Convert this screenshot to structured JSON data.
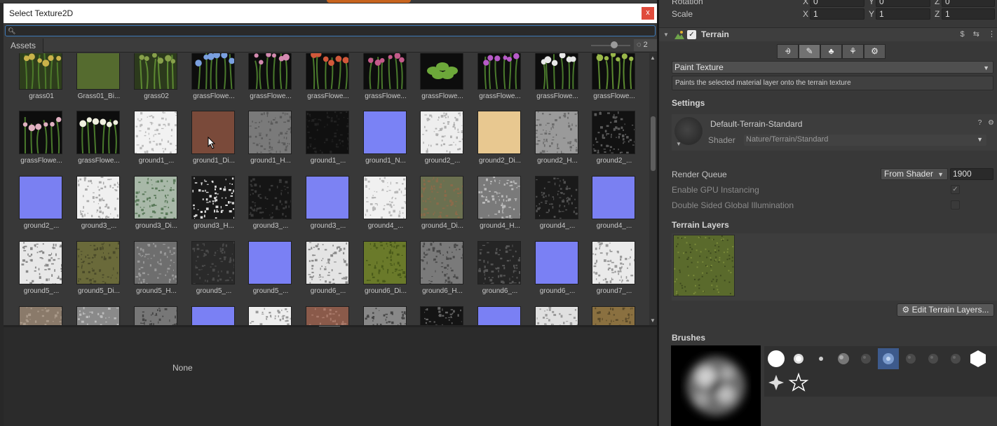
{
  "picker": {
    "title": "Select Texture2D",
    "close_label": "x",
    "search_value": "",
    "tab_assets": "Assets",
    "hidden_count": "2",
    "none_label": "None",
    "tiles": [
      {
        "label": "grass01",
        "fill": "#2e3e1c",
        "kind": "plant",
        "c1": "#4d7a2a",
        "c2": "#c9b24a"
      },
      {
        "label": "Grass01_Bi...",
        "fill": "#556b2f",
        "kind": "tex"
      },
      {
        "label": "grass02",
        "fill": "#2c3a1c",
        "kind": "plant",
        "c1": "#5d8a32",
        "c2": "#87a04a"
      },
      {
        "label": "grassFlowe...",
        "fill": "#0d0d0d",
        "kind": "plant",
        "c1": "#4a7a2c",
        "c2": "#7aa0e0"
      },
      {
        "label": "grassFlowe...",
        "fill": "#0d0d0d",
        "kind": "plant",
        "c1": "#4a7a2c",
        "c2": "#d48ab0"
      },
      {
        "label": "grassFlowe...",
        "fill": "#0d0d0d",
        "kind": "plant",
        "c1": "#4a7a2c",
        "c2": "#d2583a"
      },
      {
        "label": "grassFlowe...",
        "fill": "#0d0d0d",
        "kind": "plant",
        "c1": "#4a7a2c",
        "c2": "#c45a8a"
      },
      {
        "label": "grassFlowe...",
        "fill": "#0d0d0d",
        "kind": "leaf",
        "c1": "#6da83a",
        "c2": "#c1d27a"
      },
      {
        "label": "grassFlowe...",
        "fill": "#0d0d0d",
        "kind": "plant",
        "c1": "#4a7a2c",
        "c2": "#b75ac8"
      },
      {
        "label": "grassFlowe...",
        "fill": "#0d0d0d",
        "kind": "plant",
        "c1": "#4a7a2c",
        "c2": "#e8e8e8"
      },
      {
        "label": "grassFlowe...",
        "fill": "#0d0d0d",
        "kind": "plant",
        "c1": "#5c8a30",
        "c2": "#9ab84a"
      },
      {
        "label": "grassFlowe...",
        "fill": "#0d0d0d",
        "kind": "plant",
        "c1": "#4a7a2c",
        "c2": "#e0b0c0"
      },
      {
        "label": "grassFlowe...",
        "fill": "#0d0d0d",
        "kind": "plant",
        "c1": "#4a7a2c",
        "c2": "#f0f0e0"
      },
      {
        "label": "ground1_...",
        "fill": "#f2f2f2",
        "kind": "noise",
        "c1": "#bbbbbb"
      },
      {
        "label": "ground1_Di...",
        "fill": "#7a4a3a",
        "kind": "tex"
      },
      {
        "label": "ground1_H...",
        "fill": "#7a7a7a",
        "kind": "noise",
        "c1": "#5a5a5a"
      },
      {
        "label": "ground1_...",
        "fill": "#101010",
        "kind": "noise",
        "c1": "#222222"
      },
      {
        "label": "ground1_N...",
        "fill": "#7a82f5",
        "kind": "tex"
      },
      {
        "label": "ground2_...",
        "fill": "#eeeeee",
        "kind": "noise",
        "c1": "#b0b0b0"
      },
      {
        "label": "ground2_Di...",
        "fill": "#e8c890",
        "kind": "tex"
      },
      {
        "label": "ground2_H...",
        "fill": "#9a9a9a",
        "kind": "noise",
        "c1": "#6a6a6a"
      },
      {
        "label": "ground2_...",
        "fill": "#121212",
        "kind": "noise",
        "c1": "#5a5a5a"
      },
      {
        "label": "ground2_...",
        "fill": "#7a80f2",
        "kind": "tex"
      },
      {
        "label": "ground3_...",
        "fill": "#f0f0f0",
        "kind": "noise",
        "c1": "#aaaaaa"
      },
      {
        "label": "ground3_Di...",
        "fill": "#a8b8a8",
        "kind": "noise",
        "c1": "#5a7a5a"
      },
      {
        "label": "ground3_H...",
        "fill": "#1a1a1a",
        "kind": "noise",
        "c1": "#dddddd"
      },
      {
        "label": "ground3_...",
        "fill": "#151515",
        "kind": "noise",
        "c1": "#3a3a3a"
      },
      {
        "label": "ground3_...",
        "fill": "#7c82f3",
        "kind": "tex"
      },
      {
        "label": "ground4_...",
        "fill": "#f0f0f0",
        "kind": "noise",
        "c1": "#b8b8b8"
      },
      {
        "label": "ground4_Di...",
        "fill": "#6b7050",
        "kind": "noise",
        "c1": "#8a6a4a"
      },
      {
        "label": "ground4_H...",
        "fill": "#7a7a7a",
        "kind": "noise",
        "c1": "#bbbbbb"
      },
      {
        "label": "ground4_...",
        "fill": "#1a1a1a",
        "kind": "noise",
        "c1": "#505050"
      },
      {
        "label": "ground4_...",
        "fill": "#7a80f2",
        "kind": "tex"
      },
      {
        "label": "ground5_...",
        "fill": "#e8e8e8",
        "kind": "noise",
        "c1": "#888888"
      },
      {
        "label": "ground5_Di...",
        "fill": "#6a6a3a",
        "kind": "noise",
        "c1": "#4a4a2a"
      },
      {
        "label": "ground5_H...",
        "fill": "#6e6e6e",
        "kind": "noise",
        "c1": "#9a9a9a"
      },
      {
        "label": "ground5_...",
        "fill": "#2a2a2a",
        "kind": "noise",
        "c1": "#4a4a4a"
      },
      {
        "label": "ground5_...",
        "fill": "#7a80f4",
        "kind": "tex"
      },
      {
        "label": "ground6_...",
        "fill": "#e4e4e4",
        "kind": "noise",
        "c1": "#8a8a8a"
      },
      {
        "label": "ground6_Di...",
        "fill": "#6a7a2a",
        "kind": "noise",
        "c1": "#4a5a1a"
      },
      {
        "label": "ground6_H...",
        "fill": "#7a7a7a",
        "kind": "noise",
        "c1": "#4a4a4a"
      },
      {
        "label": "ground6_...",
        "fill": "#252525",
        "kind": "noise",
        "c1": "#555555"
      },
      {
        "label": "ground6_...",
        "fill": "#7a80f4",
        "kind": "tex"
      },
      {
        "label": "ground7_...",
        "fill": "#eaeaea",
        "kind": "noise",
        "c1": "#999999"
      },
      {
        "label": "",
        "fill": "#8a7a6a",
        "kind": "noise",
        "c1": "#aa9a8a"
      },
      {
        "label": "",
        "fill": "#8a8a8a",
        "kind": "noise",
        "c1": "#bbbbbb"
      },
      {
        "label": "",
        "fill": "#777777",
        "kind": "noise",
        "c1": "#444444"
      },
      {
        "label": "",
        "fill": "#7a80f4",
        "kind": "tex"
      },
      {
        "label": "",
        "fill": "#eeeeee",
        "kind": "noise",
        "c1": "#999999"
      },
      {
        "label": "",
        "fill": "#8a5a4a",
        "kind": "noise",
        "c1": "#aa7a6a"
      },
      {
        "label": "",
        "fill": "#888888",
        "kind": "noise",
        "c1": "#444444"
      },
      {
        "label": "",
        "fill": "#141414",
        "kind": "noise",
        "c1": "#666666"
      },
      {
        "label": "",
        "fill": "#7a80f4",
        "kind": "tex"
      },
      {
        "label": "",
        "fill": "#e0e0e0",
        "kind": "noise",
        "c1": "#9a9a9a"
      },
      {
        "label": "",
        "fill": "#8a7040",
        "kind": "noise",
        "c1": "#5a4a2a"
      }
    ]
  },
  "inspector": {
    "rotation_label": "Rotation",
    "rotation": {
      "x": "0",
      "y": "0",
      "z": "0"
    },
    "scale_label": "Scale",
    "scale": {
      "x": "1",
      "y": "1",
      "z": "1"
    },
    "axis_x": "X",
    "axis_y": "Y",
    "axis_z": "Z",
    "component_title": "Terrain",
    "component_enabled": true,
    "paint_mode": "Paint Texture",
    "help_text": "Paints the selected material layer onto the terrain texture",
    "settings_label": "Settings",
    "material_name": "Default-Terrain-Standard",
    "shader_label": "Shader",
    "shader_value": "Nature/Terrain/Standard",
    "render_queue_label": "Render Queue",
    "render_queue_mode": "From Shader",
    "render_queue_value": "1900",
    "gpu_instancing_label": "Enable GPU Instancing",
    "gpu_instancing": true,
    "double_sided_gi_label": "Double Sided Global Illumination",
    "double_sided_gi": false,
    "terrain_layers_label": "Terrain Layers",
    "edit_layers_label": "Edit Terrain Layers...",
    "brushes_label": "Brushes"
  },
  "icons": {
    "search": "search-icon",
    "close": "close-icon",
    "help": "help-icon",
    "presets": "presets-icon",
    "more": "more-icon",
    "gear": "gear-icon"
  },
  "colors": {
    "selection_blue": "#3d5a8c",
    "layer_green": "#5a6a2c"
  }
}
